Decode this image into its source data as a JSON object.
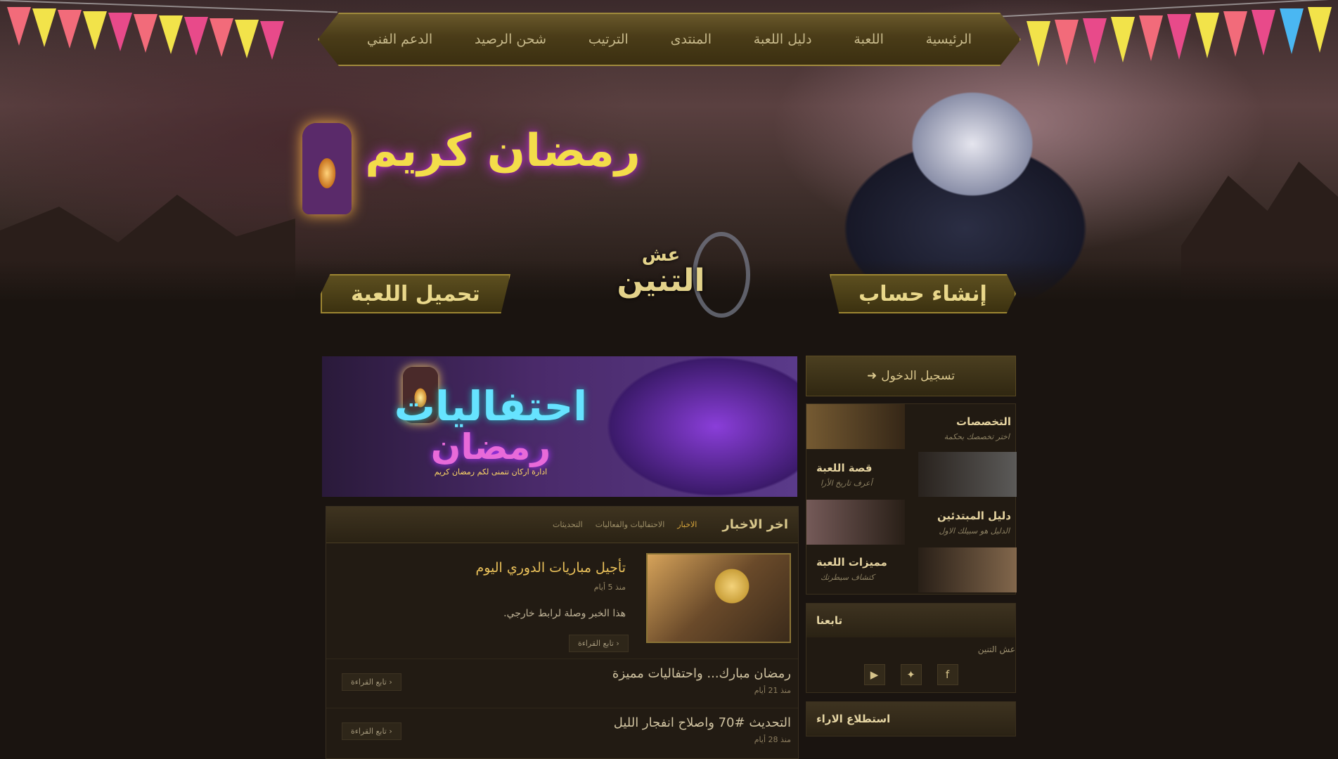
{
  "nav": {
    "items": [
      "الرئيسية",
      "اللعبة",
      "دليل اللعبة",
      "المنتدى",
      "الترتيب",
      "شحن الرصيد",
      "الدعم الفني"
    ]
  },
  "hero": {
    "ramadan_title": "رمضان كريم",
    "download_label": "تحميل اللعبة",
    "register_label": "إنشاء حساب",
    "logo_line1": "عش",
    "logo_line2": "التنين"
  },
  "banner": {
    "title_line1": "احتفاليات",
    "title_line2": "رمضان",
    "subtitle": "ادارة اركان تتمنى لكم رمضان كريم"
  },
  "news": {
    "title": "اخر الاخبار",
    "tabs": [
      "الاخبار",
      "الاحتفاليات والفعاليات",
      "التحديثات"
    ],
    "featured": {
      "title": "تأجيل مباريات الدوري اليوم",
      "date": "منذ 5 أيام",
      "description": "هذا الخبر وصلة لرابط خارجي.",
      "read_more": "تابع القراءة ›"
    },
    "items": [
      {
        "title": "رمضان مبارك... واحتفاليات مميزة",
        "date": "منذ 21 أيام",
        "read_more": "تابع القراءة ›"
      },
      {
        "title": "التحديث #70 واصلاح انفجار الليل",
        "date": "منذ 28 أيام",
        "read_more": "تابع القراءة ›"
      }
    ]
  },
  "sidebar": {
    "login_label": "تسجيل الدخول",
    "features": [
      {
        "title": "التخصصات",
        "subtitle": "اختر تخصصك بحكمة"
      },
      {
        "title": "قصة اللعبة",
        "subtitle": "أعرف تاريخ الأرا"
      },
      {
        "title": "دليل المبتدئين",
        "subtitle": "الدليل هو سبيلك الاول"
      },
      {
        "title": "مميزات اللعبة",
        "subtitle": "كتشاف سيطرتك"
      }
    ],
    "follow": {
      "title": "تابعنا",
      "name": "عش التنين",
      "networks": [
        "youtube-icon",
        "twitter-icon",
        "facebook-icon"
      ]
    },
    "poll": {
      "title": "استطلاع الاراء"
    }
  },
  "colors": {
    "accent": "#d7a53c",
    "gold": "#e9c05a",
    "bg": "#1a1410"
  }
}
